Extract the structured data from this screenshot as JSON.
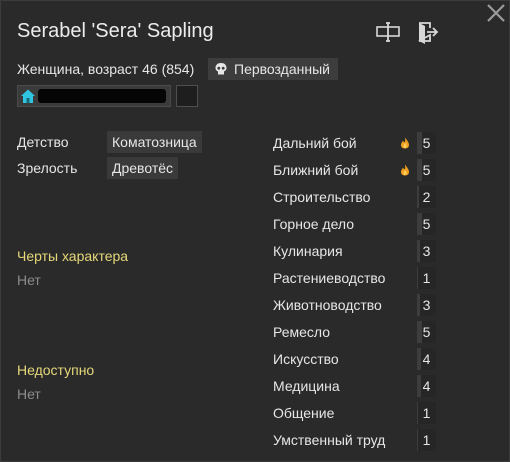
{
  "title": "Serabel 'Sera' Sapling",
  "subtitle": "Женщина, возраст 46 (854)",
  "badge": "Первозданный",
  "backstory": {
    "childhood_label": "Детство",
    "childhood_value": "Коматозница",
    "adulthood_label": "Зрелость",
    "adulthood_value": "Древотёс"
  },
  "traits": {
    "title": "Черты характера",
    "value": "Нет"
  },
  "incapable": {
    "title": "Недоступно",
    "value": "Нет"
  },
  "skills": [
    {
      "name": "Дальний бой",
      "level": "5",
      "passion": true
    },
    {
      "name": "Ближний бой",
      "level": "5",
      "passion": true
    },
    {
      "name": "Строительство",
      "level": "2",
      "passion": false
    },
    {
      "name": "Горное дело",
      "level": "5",
      "passion": false
    },
    {
      "name": "Кулинария",
      "level": "3",
      "passion": false
    },
    {
      "name": "Растениеводство",
      "level": "1",
      "passion": false
    },
    {
      "name": "Животноводство",
      "level": "3",
      "passion": false
    },
    {
      "name": "Ремесло",
      "level": "5",
      "passion": false
    },
    {
      "name": "Искусство",
      "level": "4",
      "passion": false
    },
    {
      "name": "Медицина",
      "level": "4",
      "passion": false
    },
    {
      "name": "Общение",
      "level": "1",
      "passion": false
    },
    {
      "name": "Умственный труд",
      "level": "1",
      "passion": false
    }
  ],
  "icons": {
    "close": "close-icon",
    "rename": "rename-icon",
    "banish": "banish-icon",
    "faction": "home-icon",
    "badge": "skull-icon",
    "passion": "flame-icon"
  }
}
